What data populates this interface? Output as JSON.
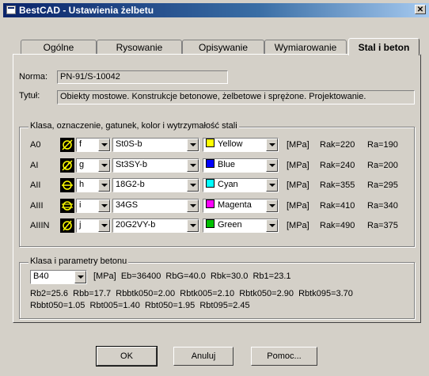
{
  "window": {
    "title": "BestCAD - Ustawienia żelbetu"
  },
  "tabs": [
    "Ogólne",
    "Rysowanie",
    "Opisywanie",
    "Wymiarowanie",
    "Stal i beton"
  ],
  "norma": {
    "label": "Norma:",
    "value": "PN-91/S-10042"
  },
  "tytul": {
    "label": "Tytuł:",
    "value": "Obiekty mostowe. Konstrukcje betonowe, żelbetowe i sprężone. Projektowanie."
  },
  "steel_group": {
    "legend": "Klasa, oznaczenie, gatunek, kolor i wytrzymałość stali",
    "rows": [
      {
        "cls": "A0",
        "symbol": "f",
        "grade": "St0S-b",
        "color_name": "Yellow",
        "color": "#ffff00",
        "unit": "[MPa]",
        "rak": "Rak=220",
        "ra": "Ra=190"
      },
      {
        "cls": "AI",
        "symbol": "g",
        "grade": "St3SY-b",
        "color_name": "Blue",
        "color": "#0000ff",
        "unit": "[MPa]",
        "rak": "Rak=240",
        "ra": "Ra=200"
      },
      {
        "cls": "AII",
        "symbol": "h",
        "grade": "18G2-b",
        "color_name": "Cyan",
        "color": "#00ffff",
        "unit": "[MPa]",
        "rak": "Rak=355",
        "ra": "Ra=295"
      },
      {
        "cls": "AIII",
        "symbol": "i",
        "grade": "34GS",
        "color_name": "Magenta",
        "color": "#ff00ff",
        "unit": "[MPa]",
        "rak": "Rak=410",
        "ra": "Ra=340"
      },
      {
        "cls": "AIIIN",
        "symbol": "j",
        "grade": "20G2VY-b",
        "color_name": "Green",
        "color": "#00c000",
        "unit": "[MPa]",
        "rak": "Rak=490",
        "ra": "Ra=375"
      }
    ]
  },
  "concrete_group": {
    "legend": "Klasa i parametry betonu",
    "class": "B40",
    "params1": "[MPa]  Eb=36400  RbG=40.0  Rbk=30.0  Rb1=23.1",
    "params2": "Rb2=25.6  Rbb=17.7  Rbbtk050=2.00  Rbtk005=2.10  Rbtk050=2.90  Rbtk095=3.70",
    "params3": "Rbbt050=1.05  Rbt005=1.40  Rbt050=1.95  Rbt095=2.45"
  },
  "buttons": {
    "ok": "OK",
    "cancel": "Anuluj",
    "help": "Pomoc..."
  }
}
